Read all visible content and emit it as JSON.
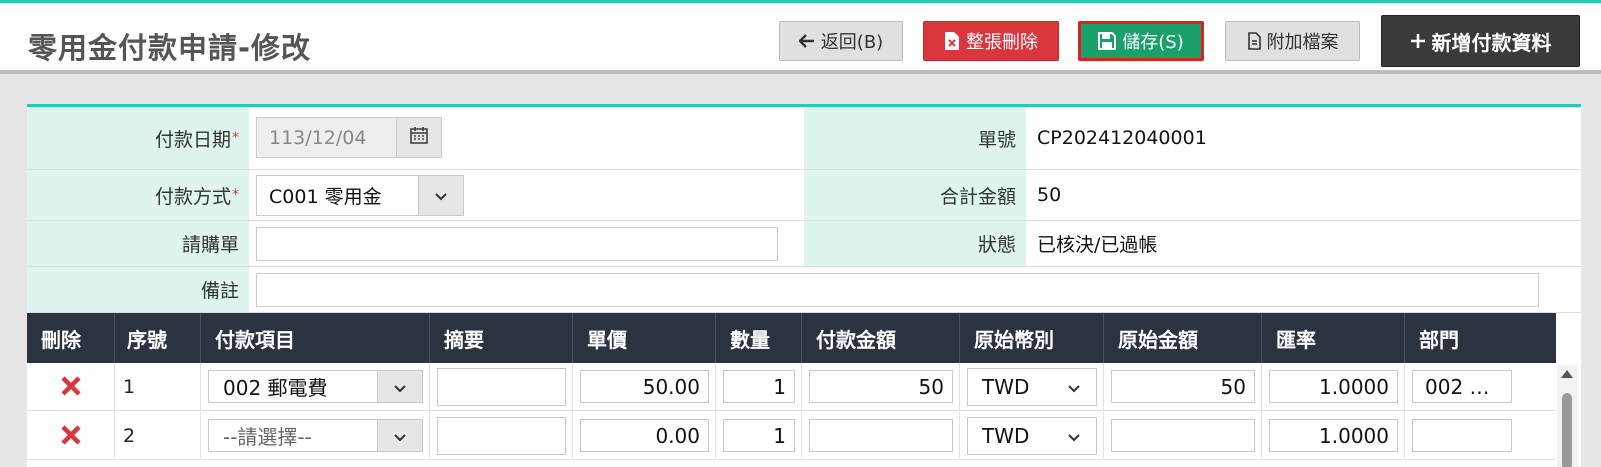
{
  "page": {
    "title": "零用金付款申請-修改"
  },
  "toolbar": {
    "back_label": "返回(B)",
    "delete_all_label": "整張刪除",
    "save_label": "儲存(S)",
    "attach_label": "附加檔案",
    "add_payment_label": "新增付款資料"
  },
  "form": {
    "pay_date_label": "付款日期",
    "pay_date_value": "113/12/04",
    "pay_method_label": "付款方式",
    "pay_method_value": "C001 零用金",
    "purchase_req_label": "請購單",
    "purchase_req_value": "",
    "remark_label": "備註",
    "remark_value": "",
    "doc_no_label": "單號",
    "doc_no_value": "CP202412040001",
    "total_label": "合計金額",
    "total_value": "50",
    "status_label": "狀態",
    "status_value": "已核決/已過帳",
    "required_mark": "*"
  },
  "grid": {
    "columns": [
      "刪除",
      "序號",
      "付款項目",
      "摘要",
      "單價",
      "數量",
      "付款金額",
      "原始幣別",
      "原始金額",
      "匯率",
      "部門"
    ],
    "rows": [
      {
        "seq": "1",
        "item": "002 郵電費",
        "summary": "",
        "unit_price": "50.00",
        "qty": "1",
        "amount": "50",
        "currency": "TWD",
        "orig_amount": "50",
        "rate": "1.0000",
        "dept": "002 …"
      },
      {
        "seq": "2",
        "item": "--請選擇--",
        "summary": "",
        "unit_price": "0.00",
        "qty": "1",
        "amount": "",
        "currency": "TWD",
        "orig_amount": "",
        "rate": "1.0000",
        "dept": ""
      }
    ]
  },
  "colors": {
    "accent": "#2ec4b6",
    "danger": "#d9363e",
    "save": "#1aa06a",
    "dark": "#3a3a3a",
    "label_bg": "#ddf5ee"
  },
  "icons": [
    "arrow-left-icon",
    "file-delete-icon",
    "floppy-icon",
    "attach-file-icon",
    "plus-icon",
    "calendar-icon",
    "chevron-down-icon",
    "close-icon"
  ]
}
